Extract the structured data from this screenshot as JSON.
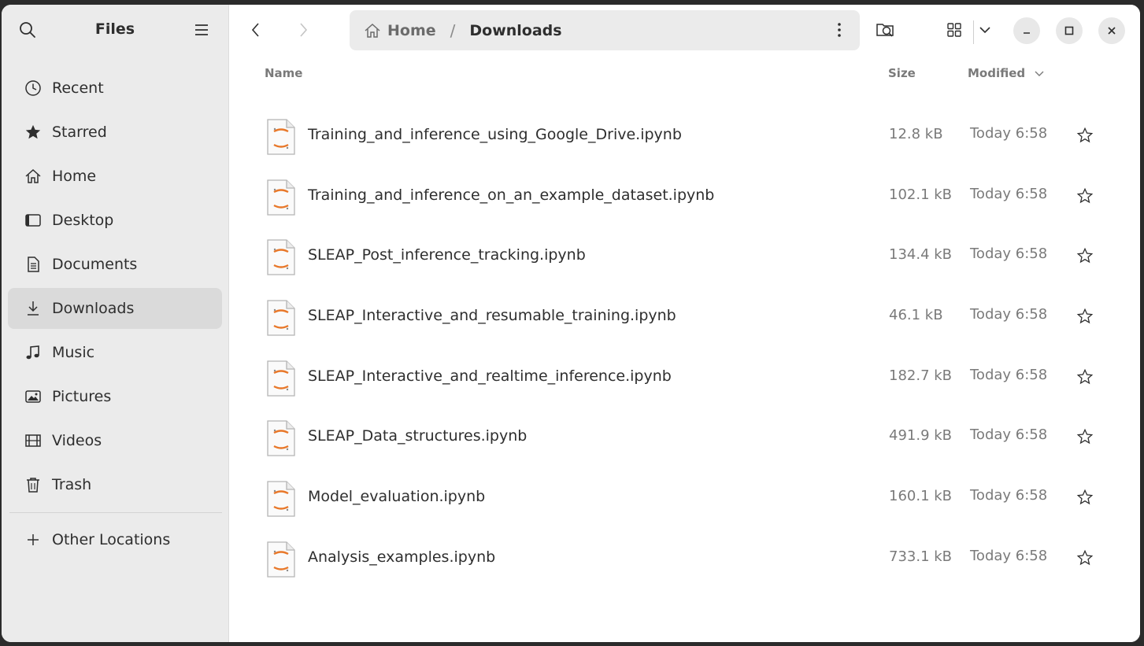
{
  "sidebar": {
    "title": "Files",
    "search_icon": "search-icon",
    "menu_icon": "hamburger-menu-icon",
    "items": [
      {
        "label": "Recent",
        "icon": "clock-icon",
        "active": false
      },
      {
        "label": "Starred",
        "icon": "star-filled-icon",
        "active": false
      },
      {
        "label": "Home",
        "icon": "home-icon",
        "active": false
      },
      {
        "label": "Desktop",
        "icon": "desktop-icon",
        "active": false
      },
      {
        "label": "Documents",
        "icon": "document-icon",
        "active": false
      },
      {
        "label": "Downloads",
        "icon": "download-icon",
        "active": true
      },
      {
        "label": "Music",
        "icon": "music-note-icon",
        "active": false
      },
      {
        "label": "Pictures",
        "icon": "picture-icon",
        "active": false
      },
      {
        "label": "Videos",
        "icon": "film-icon",
        "active": false
      },
      {
        "label": "Trash",
        "icon": "trash-icon",
        "active": false
      }
    ],
    "other_locations": {
      "label": "Other Locations",
      "icon": "plus-icon"
    }
  },
  "toolbar": {
    "back_icon": "chevron-left-icon",
    "forward_icon": "chevron-right-icon",
    "path": {
      "home_label": "Home",
      "separator": "/",
      "current_label": "Downloads"
    },
    "path_menu_icon": "vertical-dots-icon",
    "search_icon": "search-folder-icon",
    "view_icon": "grid-view-icon",
    "view_dropdown_icon": "chevron-down-icon",
    "minimize_icon": "minimize-icon",
    "maximize_icon": "maximize-icon",
    "close_icon": "close-icon"
  },
  "columns": {
    "name": "Name",
    "size": "Size",
    "modified": "Modified"
  },
  "files": [
    {
      "name": "Training_and_inference_using_Google_Drive.ipynb",
      "size": "12.8 kB",
      "modified": "Today 6:58"
    },
    {
      "name": "Training_and_inference_on_an_example_dataset.ipynb",
      "size": "102.1 kB",
      "modified": "Today 6:58"
    },
    {
      "name": "SLEAP_Post_inference_tracking.ipynb",
      "size": "134.4 kB",
      "modified": "Today 6:58"
    },
    {
      "name": "SLEAP_Interactive_and_resumable_training.ipynb",
      "size": "46.1 kB",
      "modified": "Today 6:58"
    },
    {
      "name": "SLEAP_Interactive_and_realtime_inference.ipynb",
      "size": "182.7 kB",
      "modified": "Today 6:58"
    },
    {
      "name": "SLEAP_Data_structures.ipynb",
      "size": "491.9 kB",
      "modified": "Today 6:58"
    },
    {
      "name": "Model_evaluation.ipynb",
      "size": "160.1 kB",
      "modified": "Today 6:58"
    },
    {
      "name": "Analysis_examples.ipynb",
      "size": "733.1 kB",
      "modified": "Today 6:58"
    }
  ],
  "colors": {
    "sidebar_bg": "#ebebeb",
    "active_item_bg": "#dadada",
    "notebook_accent": "#e8782a",
    "muted_text": "#7a7a7a"
  }
}
